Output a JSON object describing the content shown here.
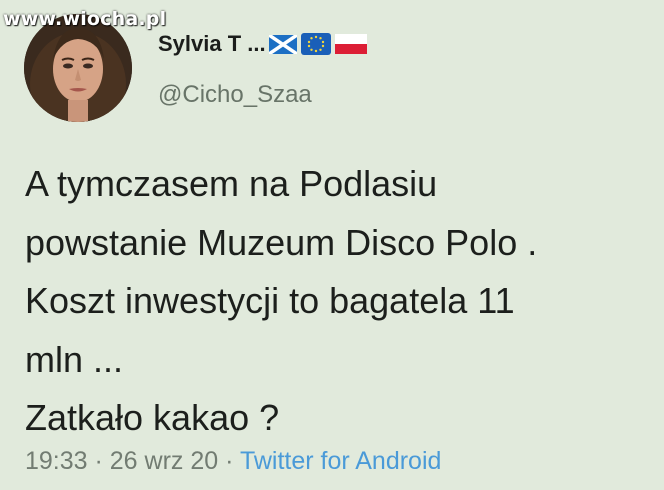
{
  "watermark": "www.wiocha.pl",
  "user": {
    "display_name": "Sylvia T ...",
    "handle": "@Cicho_Szaa",
    "flags": [
      "scotland-flag-icon",
      "eu-flag-icon",
      "poland-flag-icon"
    ]
  },
  "tweet": {
    "lines": [
      "A tymczasem na Podlasiu",
      "powstanie Muzeum Disco Polo .",
      "Koszt inwestycji to bagatela 11",
      "mln ...",
      "Zatkało kakao ?"
    ]
  },
  "meta": {
    "time": "19:33",
    "sep1": " · ",
    "date": "26 wrz 20",
    "sep2": " · ",
    "source": "Twitter for Android"
  },
  "colors": {
    "background": "#e1eadc",
    "text": "#1c1f1c",
    "muted": "#727c72",
    "link": "#4a9ad8"
  }
}
